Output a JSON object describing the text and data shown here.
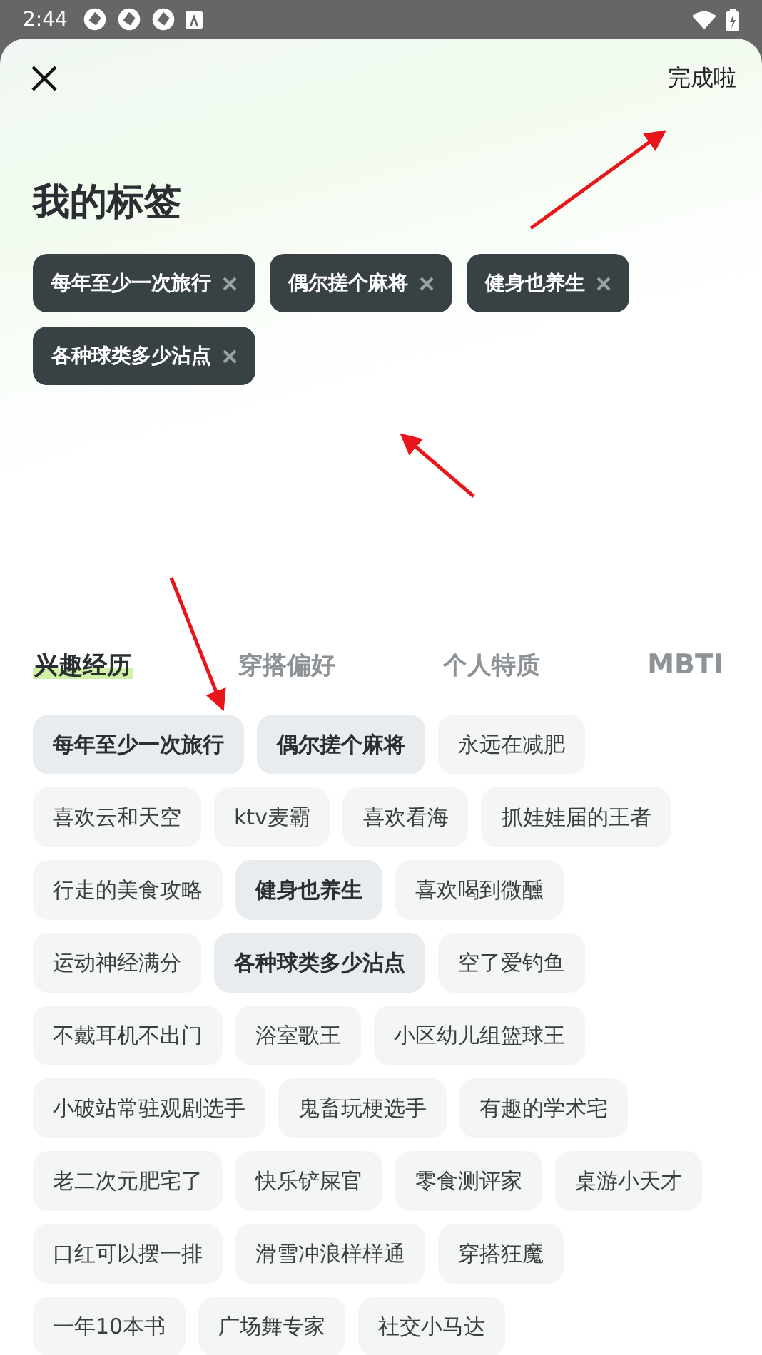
{
  "status_bar": {
    "time": "2:44"
  },
  "header": {
    "done_button": "完成啦"
  },
  "title": "我的标签",
  "my_tags": [
    {
      "label": "每年至少一次旅行"
    },
    {
      "label": "偶尔搓个麻将"
    },
    {
      "label": "健身也养生"
    },
    {
      "label": "各种球类多少沾点"
    }
  ],
  "categories": [
    {
      "label": "兴趣经历",
      "selected": true
    },
    {
      "label": "穿搭偏好",
      "selected": false
    },
    {
      "label": "个人特质",
      "selected": false
    },
    {
      "label": "MBTI",
      "selected": false
    }
  ],
  "tags": [
    {
      "label": "每年至少一次旅行",
      "selected": true
    },
    {
      "label": "偶尔搓个麻将",
      "selected": true
    },
    {
      "label": "永远在减肥",
      "selected": false
    },
    {
      "label": "喜欢云和天空",
      "selected": false
    },
    {
      "label": "ktv麦霸",
      "selected": false
    },
    {
      "label": "喜欢看海",
      "selected": false
    },
    {
      "label": "抓娃娃届的王者",
      "selected": false
    },
    {
      "label": "行走的美食攻略",
      "selected": false
    },
    {
      "label": "健身也养生",
      "selected": true
    },
    {
      "label": "喜欢喝到微醺",
      "selected": false
    },
    {
      "label": "运动神经满分",
      "selected": false
    },
    {
      "label": "各种球类多少沾点",
      "selected": true
    },
    {
      "label": "空了爱钓鱼",
      "selected": false
    },
    {
      "label": "不戴耳机不出门",
      "selected": false
    },
    {
      "label": "浴室歌王",
      "selected": false
    },
    {
      "label": "小区幼儿组篮球王",
      "selected": false
    },
    {
      "label": "小破站常驻观剧选手",
      "selected": false
    },
    {
      "label": "鬼畜玩梗选手",
      "selected": false
    },
    {
      "label": "有趣的学术宅",
      "selected": false
    },
    {
      "label": "老二次元肥宅了",
      "selected": false
    },
    {
      "label": "快乐铲屎官",
      "selected": false
    },
    {
      "label": "零食测评家",
      "selected": false
    },
    {
      "label": "桌游小天才",
      "selected": false
    },
    {
      "label": "口红可以摆一排",
      "selected": false
    },
    {
      "label": "滑雪冲浪样样通",
      "selected": false
    },
    {
      "label": "穿搭狂魔",
      "selected": false
    },
    {
      "label": "一年10本书",
      "selected": false
    },
    {
      "label": "广场舞专家",
      "selected": false
    },
    {
      "label": "社交小马达",
      "selected": false
    }
  ]
}
